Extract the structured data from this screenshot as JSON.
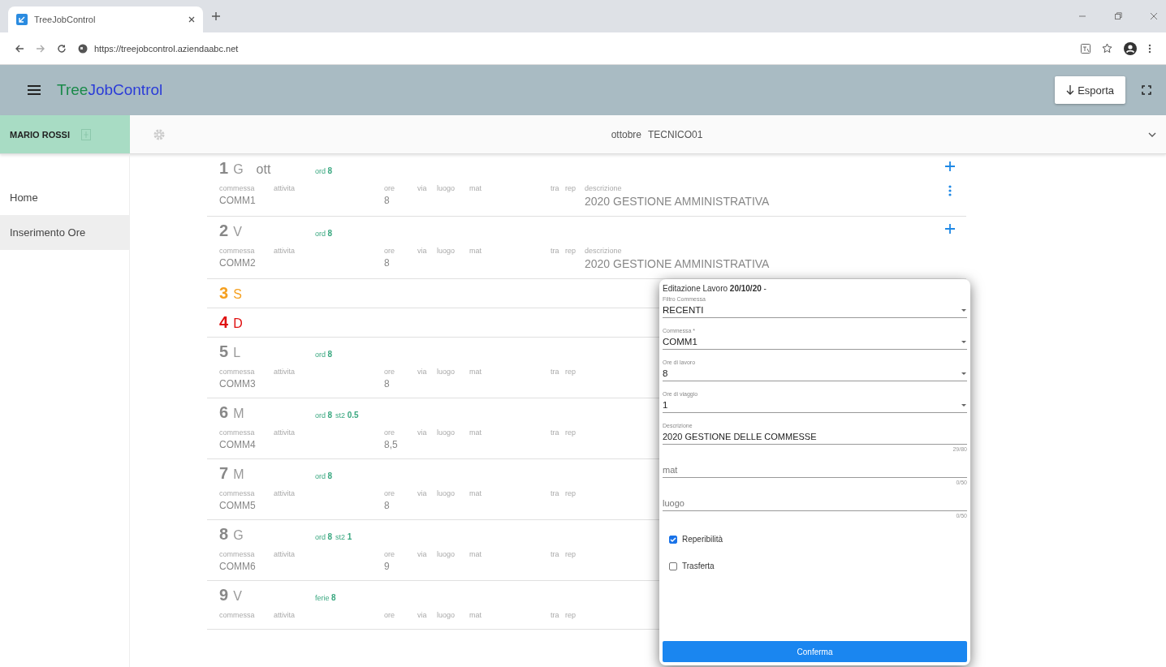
{
  "browser": {
    "tab_title": "TreeJobControl",
    "url": "https://treejobcontrol.aziendaabc.net"
  },
  "app_bar": {
    "logo_first": "Tree",
    "logo_second": "JobControl",
    "export_label": "Esporta"
  },
  "user": {
    "name": "MARIO ROSSI"
  },
  "period": {
    "month": "ottobre",
    "technician": "TECNICO01"
  },
  "sidebar": {
    "items": [
      {
        "label": "Home",
        "selected": false
      },
      {
        "label": "Inserimento Ore",
        "selected": true
      }
    ]
  },
  "days": [
    {
      "number": "1",
      "weekday": "G",
      "month": "ott",
      "hours": [
        {
          "label": "ord",
          "value": "8"
        }
      ],
      "fields": [
        {
          "label": "commessa",
          "value": "COMM1"
        },
        {
          "label": "attivita"
        },
        {
          "label": "ore",
          "value": "8"
        },
        {
          "label": "via"
        },
        {
          "label": "luogo"
        },
        {
          "label": "mat"
        },
        {
          "label": "tra"
        },
        {
          "label": "rep"
        },
        {
          "label": "descrizione",
          "value": "2020 GESTIONE AMMINISTRATIVA"
        }
      ],
      "add_button": true,
      "menu_button": true
    },
    {
      "number": "2",
      "weekday": "V",
      "hours": [
        {
          "label": "ord",
          "value": "8"
        }
      ],
      "fields": [
        {
          "label": "commessa",
          "value": "COMM2"
        },
        {
          "label": "attivita"
        },
        {
          "label": "ore",
          "value": "8"
        },
        {
          "label": "via"
        },
        {
          "label": "luogo"
        },
        {
          "label": "mat"
        },
        {
          "label": "tra"
        },
        {
          "label": "rep"
        },
        {
          "label": "descrizione",
          "value": "2020 GESTIONE AMMINISTRATIVA"
        }
      ],
      "add_button": true
    },
    {
      "number": "3",
      "weekday": "S",
      "color": "#f5a020"
    },
    {
      "number": "4",
      "weekday": "D",
      "color": "#e01010"
    },
    {
      "number": "5",
      "weekday": "L",
      "hours": [
        {
          "label": "ord",
          "value": "8"
        }
      ],
      "fields": [
        {
          "label": "commessa",
          "value": "COMM3"
        },
        {
          "label": "attivita"
        },
        {
          "label": "ore",
          "value": "8"
        },
        {
          "label": "via"
        },
        {
          "label": "luogo"
        },
        {
          "label": "mat"
        },
        {
          "label": "tra"
        },
        {
          "label": "rep"
        }
      ]
    },
    {
      "number": "6",
      "weekday": "M",
      "hours": [
        {
          "label": "ord",
          "value": "8"
        },
        {
          "label": "st2",
          "value": "0.5"
        }
      ],
      "fields": [
        {
          "label": "commessa",
          "value": "COMM4"
        },
        {
          "label": "attivita"
        },
        {
          "label": "ore",
          "value": "8,5"
        },
        {
          "label": "via"
        },
        {
          "label": "luogo"
        },
        {
          "label": "mat"
        },
        {
          "label": "tra"
        },
        {
          "label": "rep"
        }
      ]
    },
    {
      "number": "7",
      "weekday": "M",
      "hours": [
        {
          "label": "ord",
          "value": "8"
        }
      ],
      "fields": [
        {
          "label": "commessa",
          "value": "COMM5"
        },
        {
          "label": "attivita"
        },
        {
          "label": "ore",
          "value": "8"
        },
        {
          "label": "via"
        },
        {
          "label": "luogo"
        },
        {
          "label": "mat"
        },
        {
          "label": "tra"
        },
        {
          "label": "rep"
        }
      ]
    },
    {
      "number": "8",
      "weekday": "G",
      "hours": [
        {
          "label": "ord",
          "value": "8"
        },
        {
          "label": "st2",
          "value": "1"
        }
      ],
      "fields": [
        {
          "label": "commessa",
          "value": "COMM6"
        },
        {
          "label": "attivita"
        },
        {
          "label": "ore",
          "value": "9"
        },
        {
          "label": "via"
        },
        {
          "label": "luogo"
        },
        {
          "label": "mat"
        },
        {
          "label": "tra"
        },
        {
          "label": "rep"
        }
      ]
    },
    {
      "number": "9",
      "weekday": "V",
      "hours": [
        {
          "label": "ferie",
          "value": "8"
        }
      ],
      "fields": [
        {
          "label": "commessa"
        },
        {
          "label": "attivita"
        },
        {
          "label": "ore"
        },
        {
          "label": "via"
        },
        {
          "label": "luogo"
        },
        {
          "label": "mat"
        },
        {
          "label": "tra"
        },
        {
          "label": "rep"
        }
      ]
    }
  ],
  "dialog": {
    "title": "Editazione Lavoro **20/10/20** -",
    "fields": [
      {
        "kind": "select",
        "label": "Filtro Commessa",
        "value": "RECENTI"
      },
      {
        "kind": "select",
        "label": "Commessa *",
        "value": "COMM1"
      },
      {
        "kind": "select",
        "label": "Ore di lavoro",
        "value": "8"
      },
      {
        "kind": "select",
        "label": "Ore di viaggio",
        "value": "1"
      },
      {
        "kind": "text",
        "label": "Descrizione",
        "value": "2020 GESTIONE DELLE COMMESSE",
        "counter": "29/80"
      },
      {
        "kind": "text",
        "placeholder": "mat",
        "counter": "0/50"
      },
      {
        "kind": "text",
        "placeholder": "luogo",
        "counter": "0/50"
      }
    ],
    "checkboxes": [
      {
        "label": "Reperibilità",
        "checked": true
      },
      {
        "label": "Trasferta",
        "checked": false
      }
    ],
    "confirm_label": "Conferma"
  }
}
